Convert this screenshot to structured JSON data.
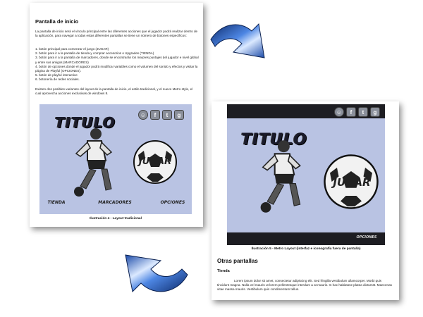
{
  "page1": {
    "heading": "Pantalla de inicio",
    "intro": "La pantalla de inicio será el vínculo principal entre las diferentes acciones que el jugador podrá realizar dentro de la aplicación, para navegar a todas estas diferentes pantallas se tiene un número de botones específicos:",
    "items": [
      "1. botón principal para comenzar el juego (JUGAR)",
      "2. botón para ir a la pantalla de tienda y comprar accesorios o Upgrades (TIENDA)",
      "3. botón para ir a la pantalla de marcadores, donde se encontrarán los mejores puntajes del jugador e nivel global y entre sus amigos (MARCADORES)",
      "4. botón de opciones donde el jugador podrá modificar variables como el volumen del sonido y efectos y visitar la página de Playful (OPCIONES).",
      "5. botón de playful interactive",
      "6. botonería de redes sociales."
    ],
    "closing": "Existen dos posibles variantes del layout de la pantalla de inicio, el estilo tradicional, y el nuevo Metro style, el cual aprovecha acciones exclusivas de windows 8.",
    "caption": "Ilustración 4 - Layout tradicional",
    "screen": {
      "title": "TITULO",
      "play": "JUGAR",
      "buttons": [
        "TIENDA",
        "MARCADORES",
        "OPCIONES"
      ]
    }
  },
  "page2": {
    "caption": "Ilustración 5 - Metro Layout (interfaz e iconografía fuera de pantalla)",
    "section_title": "Otras pantallas",
    "subsection": "Tienda",
    "lorem": "Lorem ipsum dolor sit amet, consectetur adipiscing elit. Sed fringilla vestibulum ullamcorper. Morbi quis tincidunt magna. Nulla vel mauris ut lorem pellentesque interdum a at mauris. In hac habitasse platea dictumst. Maecenas vitae massa mauris. Vestibulum quis condimentum tellus.",
    "screen": {
      "title": "TITULO",
      "play": "JUGAR",
      "footer_button": "OPCIONES"
    }
  },
  "social_icons": [
    "smiley-icon",
    "facebook-icon",
    "twitter-icon",
    "google-plus-icon"
  ],
  "colors": {
    "screen_bg": "#b9c3e3",
    "dark_band": "#1d1d22",
    "arrow_blue": "#2f63c8",
    "arrow_light": "#cfe2ff"
  }
}
